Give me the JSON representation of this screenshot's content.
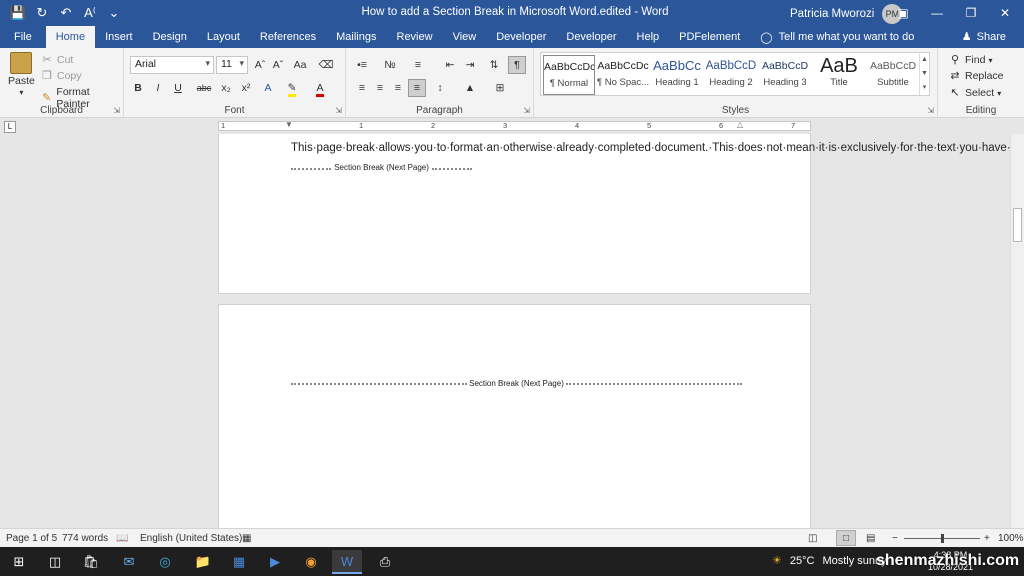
{
  "titlebar": {
    "title": "How to add a Section Break in Microsoft Word.edited  -  Word",
    "user_name": "Patricia Mworozi",
    "user_initials": "PM",
    "qat": [
      "save-icon",
      "autosave-icon",
      "undo-icon",
      "font-size-icon",
      "customize-icon"
    ]
  },
  "tabs": [
    "File",
    "Home",
    "Insert",
    "Design",
    "Layout",
    "References",
    "Mailings",
    "Review",
    "View",
    "Developer",
    "Developer",
    "Help",
    "PDFelement"
  ],
  "active_tab": "Home",
  "tellme": "Tell me what you want to do",
  "share": "Share",
  "ribbon": {
    "clipboard": {
      "label": "Clipboard",
      "paste": "Paste",
      "cut": "Cut",
      "copy": "Copy",
      "format_painter": "Format Painter"
    },
    "font": {
      "label": "Font",
      "font_name": "Arial",
      "font_size": "11",
      "grow": "Aˆ",
      "shrink": "Aˇ",
      "change_case": "Aa",
      "bold": "B",
      "italic": "I",
      "underline": "U",
      "strike": "abc",
      "subscript": "x₂",
      "superscript": "x²"
    },
    "paragraph": {
      "label": "Paragraph",
      "pilcrow": "¶"
    },
    "styles": {
      "label": "Styles",
      "items": [
        {
          "preview": "AaBbCcDc",
          "name": "¶ Normal"
        },
        {
          "preview": "AaBbCcDc",
          "name": "¶ No Spac..."
        },
        {
          "preview": "AaBbCc",
          "name": "Heading 1"
        },
        {
          "preview": "AaBbCcD",
          "name": "Heading 2"
        },
        {
          "preview": "AaBbCcD",
          "name": "Heading 3"
        },
        {
          "preview": "AaB",
          "name": "Title"
        },
        {
          "preview": "AaBbCcD",
          "name": "Subtitle"
        }
      ]
    },
    "editing": {
      "label": "Editing",
      "find": "Find",
      "replace": "Replace",
      "select": "Select"
    }
  },
  "ruler": [
    "1",
    "1",
    "2",
    "3",
    "4",
    "5",
    "6",
    "7"
  ],
  "document": {
    "paragraph": "This·page·break·allows·you·to·format·an·otherwise·already·completed·document.·This·does·not·mean·it·is·exclusively·for·the·text·you·have·finished,·for·the·most·part.·But·this·is·when·it·is·most·helpful.·Essentially,·you·do·not·want·to·move·any·text·around.·Instead,·you·want·to·partition·it·and·format·footnotes,·headings·and·pages.¶",
    "section_break_1": "Section Break (Next Page)",
    "section_break_2": "Section Break (Next Page)"
  },
  "status": {
    "page": "Page 1 of 5",
    "words": "774 words",
    "language": "English (United States)",
    "zoom": "100%",
    "zoom_level": 1.0
  },
  "taskbar": {
    "temperature": "25°C",
    "weather_text": "Mostly sunny",
    "time": "4:38 PM",
    "date": "10/28/2021"
  },
  "watermark": "shenmazhishi.com"
}
